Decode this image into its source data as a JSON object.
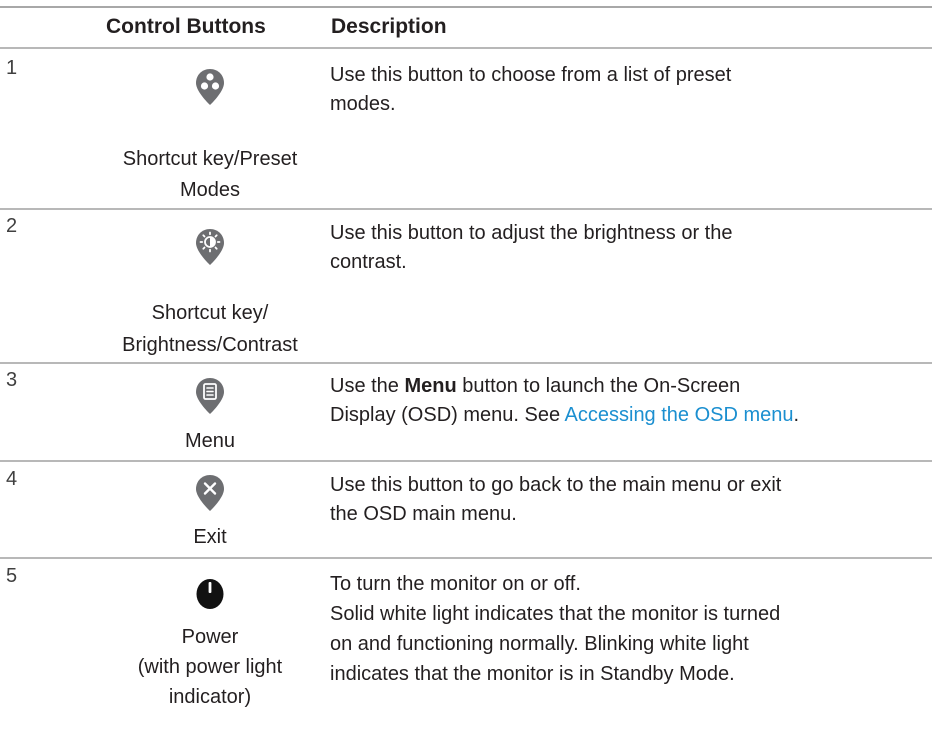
{
  "header": {
    "col_buttons": "Control Buttons",
    "col_description": "Description"
  },
  "rows": [
    {
      "number": "1",
      "icon": "preset-modes-icon",
      "caption_line1": "Shortcut key/Preset",
      "caption_line2": "Modes",
      "desc_line1": "Use this button to choose from a list of preset",
      "desc_line2": "modes."
    },
    {
      "number": "2",
      "icon": "brightness-contrast-icon",
      "caption_line1": "Shortcut key/",
      "caption_line2": "Brightness/Contrast",
      "desc_line1": "Use this button to adjust the brightness or the",
      "desc_line2": "contrast."
    },
    {
      "number": "3",
      "icon": "menu-icon",
      "caption_line1": "Menu",
      "desc_pre": "Use the ",
      "desc_bold": "Menu",
      "desc_post": " button to launch the On-Screen",
      "desc_line2_pre": "Display (OSD) menu. See ",
      "desc_link": "Accessing the OSD menu",
      "desc_line2_post": "."
    },
    {
      "number": "4",
      "icon": "exit-icon",
      "caption_line1": "Exit",
      "desc_line1": "Use this button to go back to the main menu or exit",
      "desc_line2": "the OSD main menu."
    },
    {
      "number": "5",
      "icon": "power-icon",
      "caption_line1": "Power",
      "caption_line2": "(with power light",
      "caption_line3": "indicator)",
      "desc_line1": "To turn the monitor on or off.",
      "desc_line2": "Solid white light indicates that the monitor is turned",
      "desc_line3": "on and functioning normally. Blinking white light",
      "desc_line4": "indicates that the monitor is in Standby Mode."
    }
  ],
  "colors": {
    "icon": "#6d6e71",
    "link": "#1b8fd0",
    "rule": "#b8b8b8",
    "text": "#231f20"
  }
}
